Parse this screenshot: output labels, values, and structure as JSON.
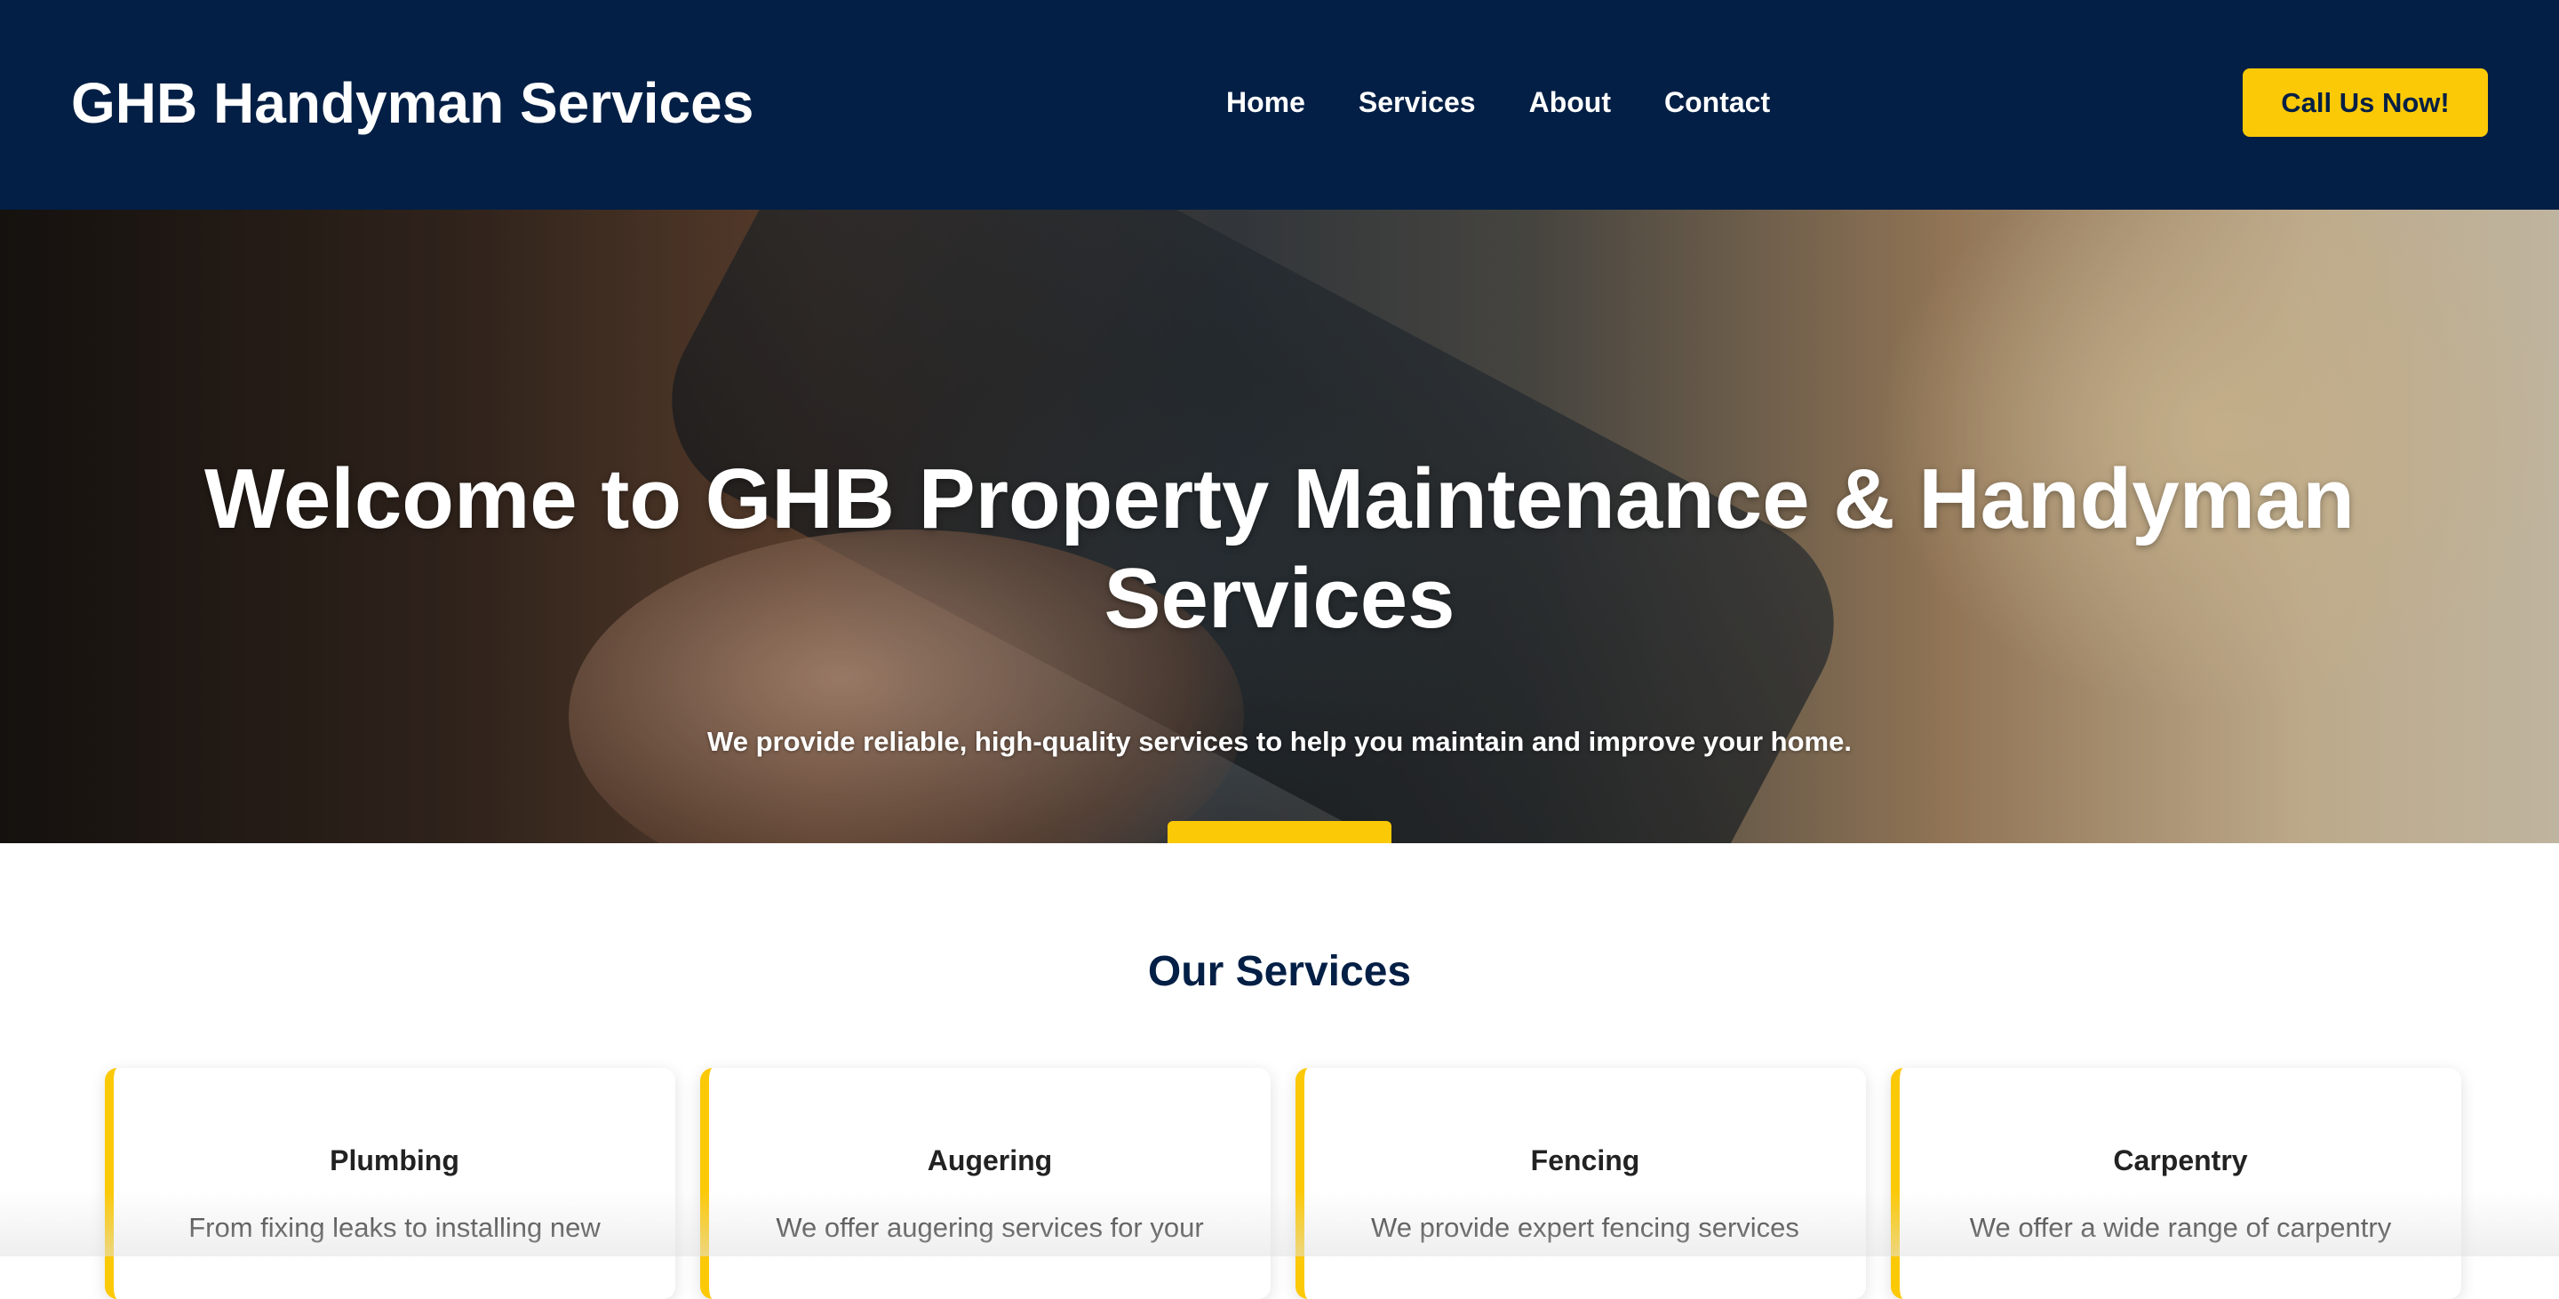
{
  "header": {
    "brand": "GHB Handyman Services",
    "nav": [
      "Home",
      "Services",
      "About",
      "Contact"
    ],
    "cta_label": "Call Us Now!"
  },
  "hero": {
    "title": "Welcome to GHB Property Maintenance & Handyman Services",
    "subtitle": "We provide reliable, high-quality services to help you maintain and improve your home."
  },
  "services": {
    "heading": "Our Services",
    "cards": [
      {
        "title": "Plumbing",
        "text": "From fixing leaks to installing new"
      },
      {
        "title": "Augering",
        "text": "We offer augering services for your"
      },
      {
        "title": "Fencing",
        "text": "We provide expert fencing services"
      },
      {
        "title": "Carpentry",
        "text": "We offer a wide range of carpentry"
      }
    ]
  },
  "colors": {
    "navy": "#031f45",
    "accent_yellow": "#fcc907",
    "white": "#ffffff"
  }
}
